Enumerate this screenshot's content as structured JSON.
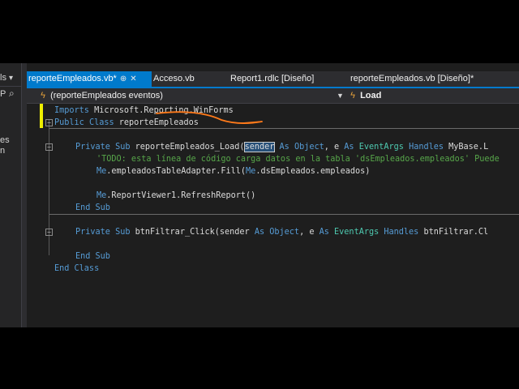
{
  "left_panel": {
    "items": [
      "ls",
      "P",
      "es",
      "n"
    ]
  },
  "tabs": [
    {
      "label": "reporteEmpleados.vb*",
      "pin": "⊕",
      "close": "✕",
      "active": true
    },
    {
      "label": "Acceso.vb",
      "active": false
    },
    {
      "label": "Report1.rdlc [Diseño]",
      "active": false
    },
    {
      "label": "reporteEmpleados.vb [Diseño]*",
      "active": false
    }
  ],
  "navbar": {
    "scope": "(reporteEmpleados eventos)",
    "member": "Load"
  },
  "code": {
    "line1": {
      "kw": "Imports",
      "rest": " Microsoft.Reporting.WinForms"
    },
    "line2": {
      "kw1": "Public",
      "kw2": "Class",
      "name": " reporteEmpleados"
    },
    "line4": {
      "kw1": "Private",
      "kw2": "Sub",
      "name": " reporteEmpleados_Load(",
      "sel": "sender",
      "kw3": "As",
      "ty1": "Object",
      "sep": ", e ",
      "kw4": "As",
      "ty2": "EventArgs",
      "kw5": "Handles",
      "tail": " MyBase.L"
    },
    "line5": "'TODO: esta línea de código carga datos en la tabla 'dsEmpleados.empleados' Puede",
    "line6": {
      "kw1": "Me",
      "mid": ".empleadosTableAdapter.Fill(",
      "kw2": "Me",
      "end": ".dsEmpleados.empleados)"
    },
    "line8": {
      "kw": "Me",
      "rest": ".ReportViewer1.RefreshReport()"
    },
    "line9": {
      "kw": "End Sub"
    },
    "line11": {
      "kw1": "Private",
      "kw2": "Sub",
      "name": " btnFiltrar_Click(sender ",
      "kw3": "As",
      "ty1": "Object",
      "sep": ", e ",
      "kw4": "As",
      "ty2": "EventArgs",
      "kw5": "Handles",
      "tail": " btnFiltrar.Cl"
    },
    "line13": {
      "kw": "End Sub"
    },
    "line14": {
      "kw": "End Class"
    }
  },
  "colors": {
    "keyword": "#569cd6",
    "type": "#4ec9b0",
    "comment": "#57a64a",
    "active_tab": "#007acc",
    "annotation": "#ff7a1a"
  }
}
